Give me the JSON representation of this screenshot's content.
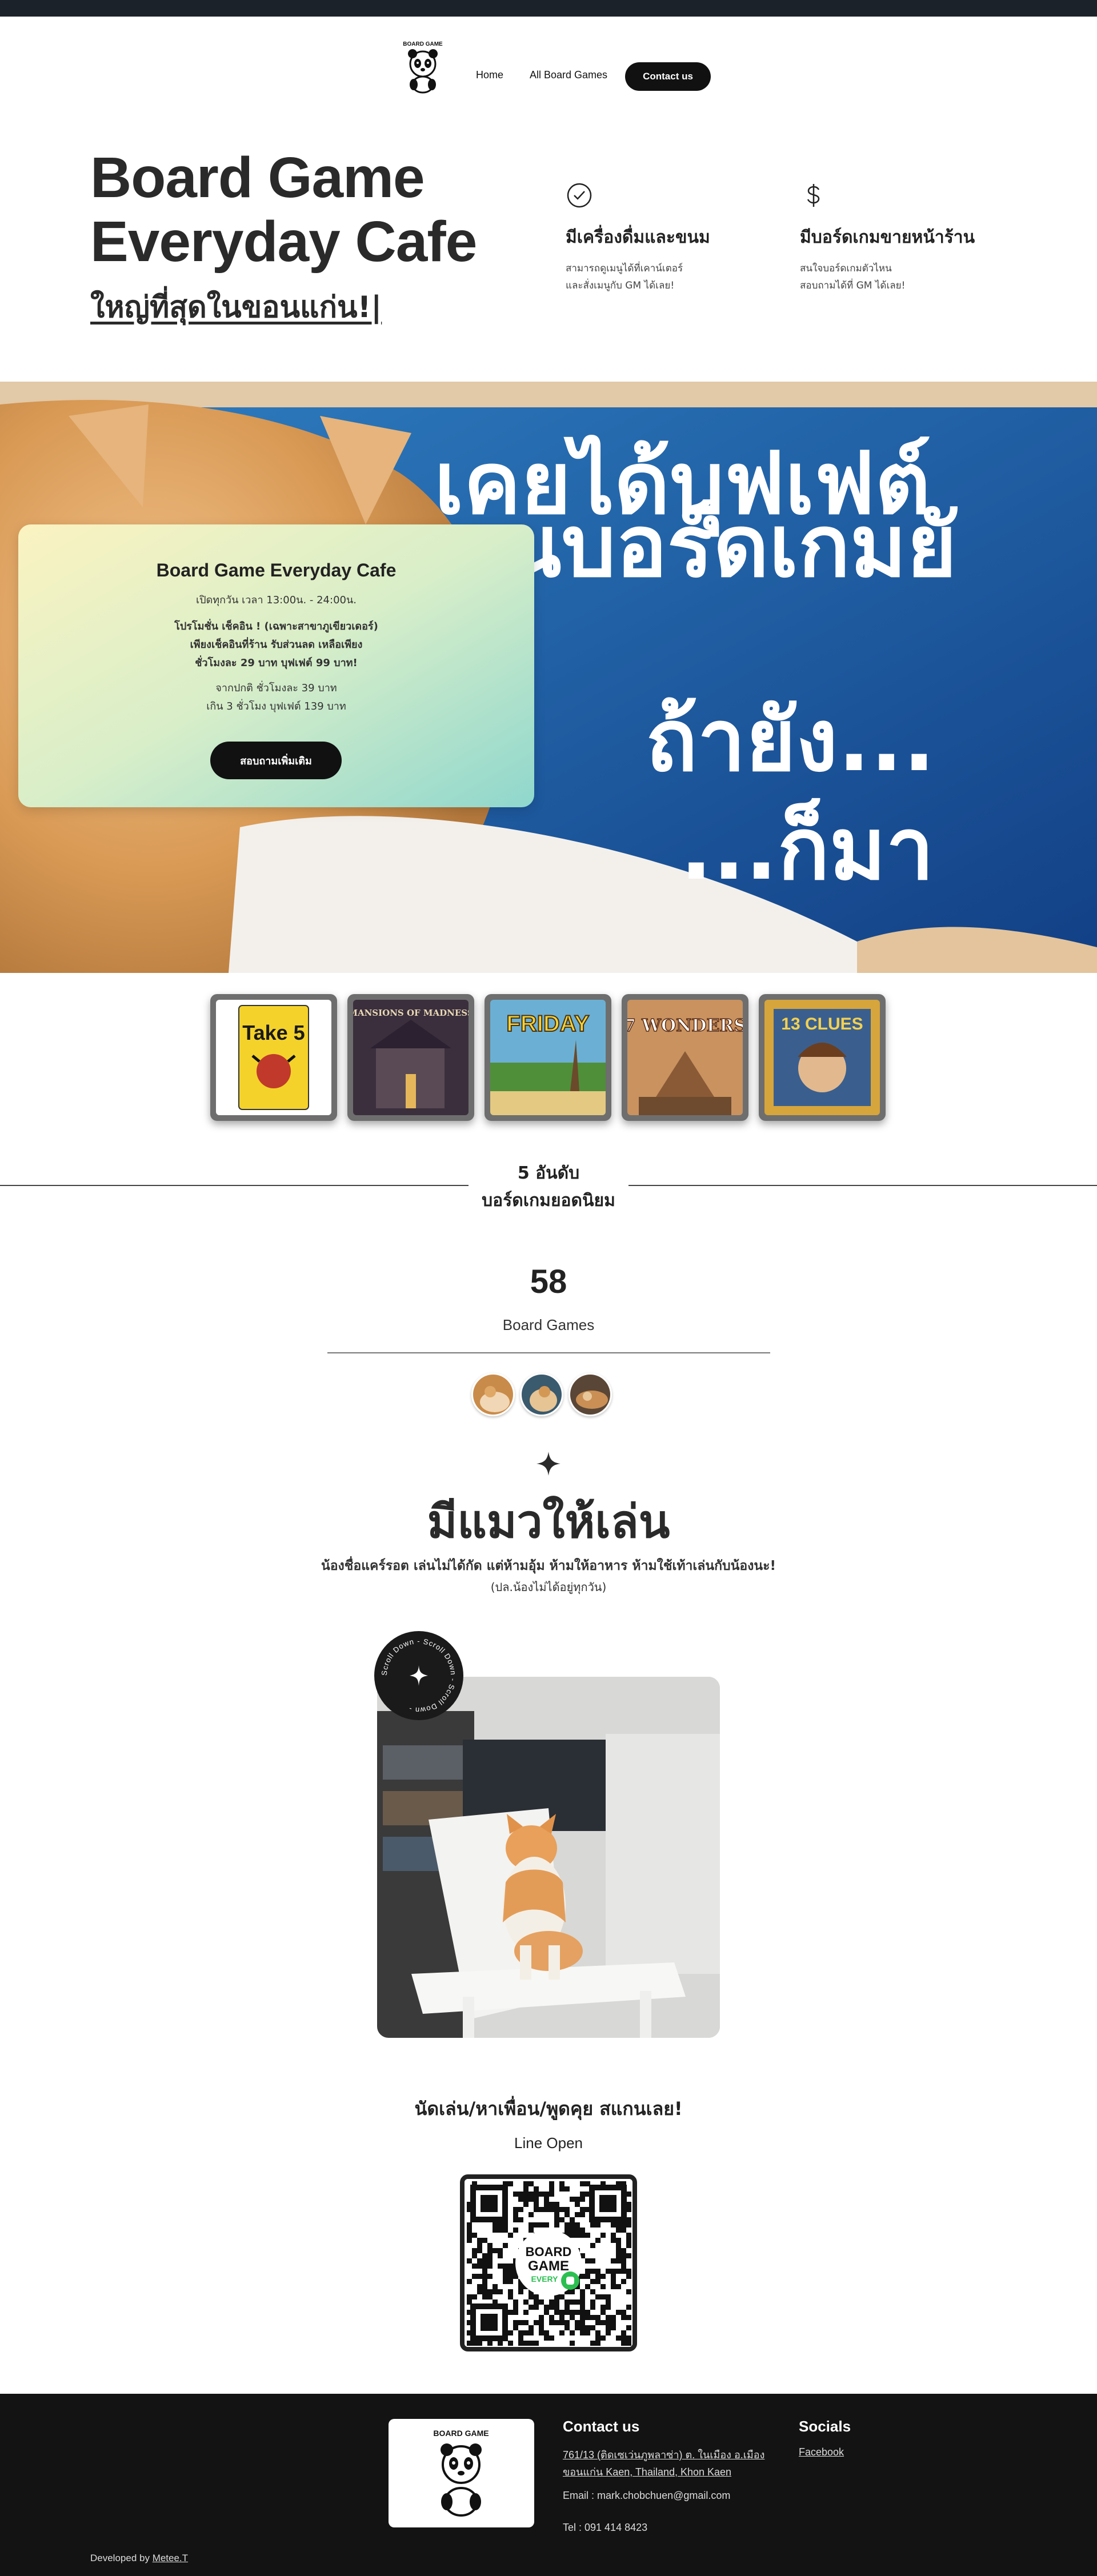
{
  "nav": {
    "logo_text": "BOARD GAME",
    "home": "Home",
    "all_games": "All Board Games",
    "contact": "Contact us"
  },
  "hero": {
    "title_line1": "Board Game",
    "title_line2": "Everyday Cafe",
    "subtitle": "ใหญ่ที่สุดในขอนแก่น!|"
  },
  "features": [
    {
      "icon": "check-circle-icon",
      "title": "มีเครื่องดื่มและขนม",
      "line1": "สามารถดูเมนูได้ที่เคาน์เตอร์",
      "line2": "และสั่งเมนูกับ GM ได้เลย!"
    },
    {
      "icon": "dollar-icon",
      "title": "มีบอร์ดเกมขายหน้าร้าน",
      "line1": "สนใจบอร์ดเกมตัวไหน",
      "line2": "สอบถามได้ที่ GM ได้เลย!"
    }
  ],
  "banner": {
    "overlay_line1": "เคยได้บุฟเฟต์",
    "overlay_line2": "นบอร์ดเกมยั",
    "overlay_line3": "ถ้ายัง...",
    "overlay_line4": "...ก็มา"
  },
  "promo": {
    "title": "Board Game Everyday Cafe",
    "hours": "เปิดทุกวัน เวลา 13:00น. - 24:00น.",
    "promo_line1": "โปรโมชั่น เช็คอิน ! (เฉพาะสาขาภูเขียวเดอร์)",
    "promo_line2": "เพียงเช็คอินที่ร้าน รับส่วนลด เหลือเพียง",
    "promo_line3": "ชั่วโมงละ 29 บาท บุฟเฟต์ 99 บาท!",
    "normal_line1": "จากปกติ ชั่วโมงละ 39 บาท",
    "normal_line2": "เกิน 3 ชั่วโมง บุฟเฟต์ 139 บาท",
    "button": "สอบถามเพิ่มเติม"
  },
  "games": [
    {
      "name": "Take 5",
      "color": "#f4d22a"
    },
    {
      "name": "MANSIONS OF MADNESS",
      "color": "#4a3a4a"
    },
    {
      "name": "FRIDAY",
      "color": "#4f8f3a"
    },
    {
      "name": "7 WONDERS",
      "color": "#b07a55"
    },
    {
      "name": "13 CLUES",
      "color": "#335a8a"
    }
  ],
  "top5": {
    "line1": "5 อันดับ",
    "line2": "บอร์ดเกมยอดนิยม"
  },
  "stats": {
    "count": "58",
    "label": "Board Games"
  },
  "cats": {
    "title": "มีแมวให้เล่น",
    "text": "น้องชื่อแคร์รอต เล่นไม่ได้กัด แต่ห้ามอุ้ม ห้ามให้อาหาร ห้ามใช้เท้าเล่นกับน้องนะ!",
    "note": "(ปล.น้องไม่ได้อยู่ทุกวัน)",
    "scroll_badge": "Scroll Down - Scroll Down - Scroll Down - "
  },
  "cta": {
    "title": "นัดเล่น/หาเพื่อน/พูดคุย สแกนเลย!",
    "sub": "Line Open",
    "qr_label_1": "BOARD",
    "qr_label_2": "GAME",
    "qr_label_3": "EVERY"
  },
  "footer": {
    "contact_heading": "Contact us",
    "address": "761/13 (ติดเซเว่นภูพลาซ่า) ต. ในเมือง อ.เมือง ขอนแก่น Kaen, Thailand, Khon Kaen",
    "email": "Email : mark.chobchuen@gmail.com",
    "tel": "Tel : 091 414 8423",
    "socials_heading": "Socials",
    "facebook": "Facebook",
    "dev_prefix": "Developed by ",
    "dev_name": "Metee.T"
  },
  "colors": {
    "dark": "#111111",
    "banner_blue": "#1b5aa6",
    "promo_gradient_start": "#fbf3c1",
    "promo_gradient_end": "#8fd7cd",
    "footer_bg": "#131313"
  }
}
